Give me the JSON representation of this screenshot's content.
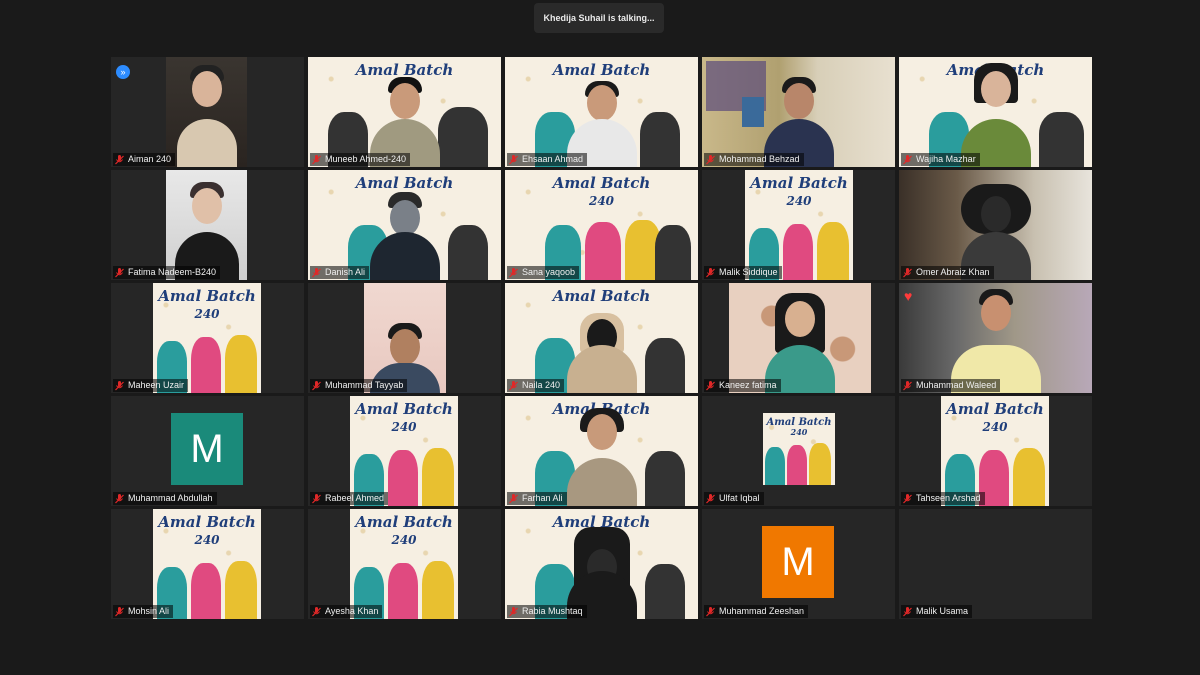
{
  "status": {
    "talking": "Khedija Suhail is talking..."
  },
  "banner": {
    "title": "Amal Batch",
    "subtitle": "240"
  },
  "colors": {
    "accent_blue": "#2d8cff",
    "mic_muted": "#e02828",
    "avatar_teal": "#1a8a7a",
    "avatar_orange": "#f07800"
  },
  "participants": [
    {
      "name": "Aiman 240",
      "media": "video",
      "icon": "pin-chevron-icon"
    },
    {
      "name": "Muneeb Ahmed-240",
      "media": "banner"
    },
    {
      "name": "Ehsaan Ahmad",
      "media": "banner"
    },
    {
      "name": "Mohammad Behzad",
      "media": "video"
    },
    {
      "name": "Wajiha Mazhar",
      "media": "banner"
    },
    {
      "name": "Fatima Nadeem-B240",
      "media": "video"
    },
    {
      "name": "Danish Ali",
      "media": "banner"
    },
    {
      "name": "Sana yaqoob",
      "media": "banner"
    },
    {
      "name": "Malik Siddique",
      "media": "banner"
    },
    {
      "name": "Omer Abraiz Khan",
      "media": "video"
    },
    {
      "name": "Maheen Uzair",
      "media": "banner"
    },
    {
      "name": "Muhammad Tayyab",
      "media": "video"
    },
    {
      "name": "Naila 240",
      "media": "banner"
    },
    {
      "name": "Kaneez fatima",
      "media": "video"
    },
    {
      "name": "Muhammad Waleed",
      "media": "video",
      "icon": "heart-icon"
    },
    {
      "name": "Muhammad Abdullah",
      "media": "avatar",
      "avatar_letter": "M"
    },
    {
      "name": "Rabeel Ahmed",
      "media": "banner"
    },
    {
      "name": "Farhan Ali",
      "media": "banner"
    },
    {
      "name": "Ulfat Iqbal",
      "media": "banner"
    },
    {
      "name": "Tahseen Arshad",
      "media": "banner"
    },
    {
      "name": "Mohsin Ali",
      "media": "banner"
    },
    {
      "name": "Ayesha Khan",
      "media": "banner"
    },
    {
      "name": "Rabia Mushtaq",
      "media": "banner"
    },
    {
      "name": "Muhammad Zeeshan",
      "media": "avatar",
      "avatar_letter": "M"
    },
    {
      "name": "Malik Usama",
      "media": "none"
    }
  ]
}
